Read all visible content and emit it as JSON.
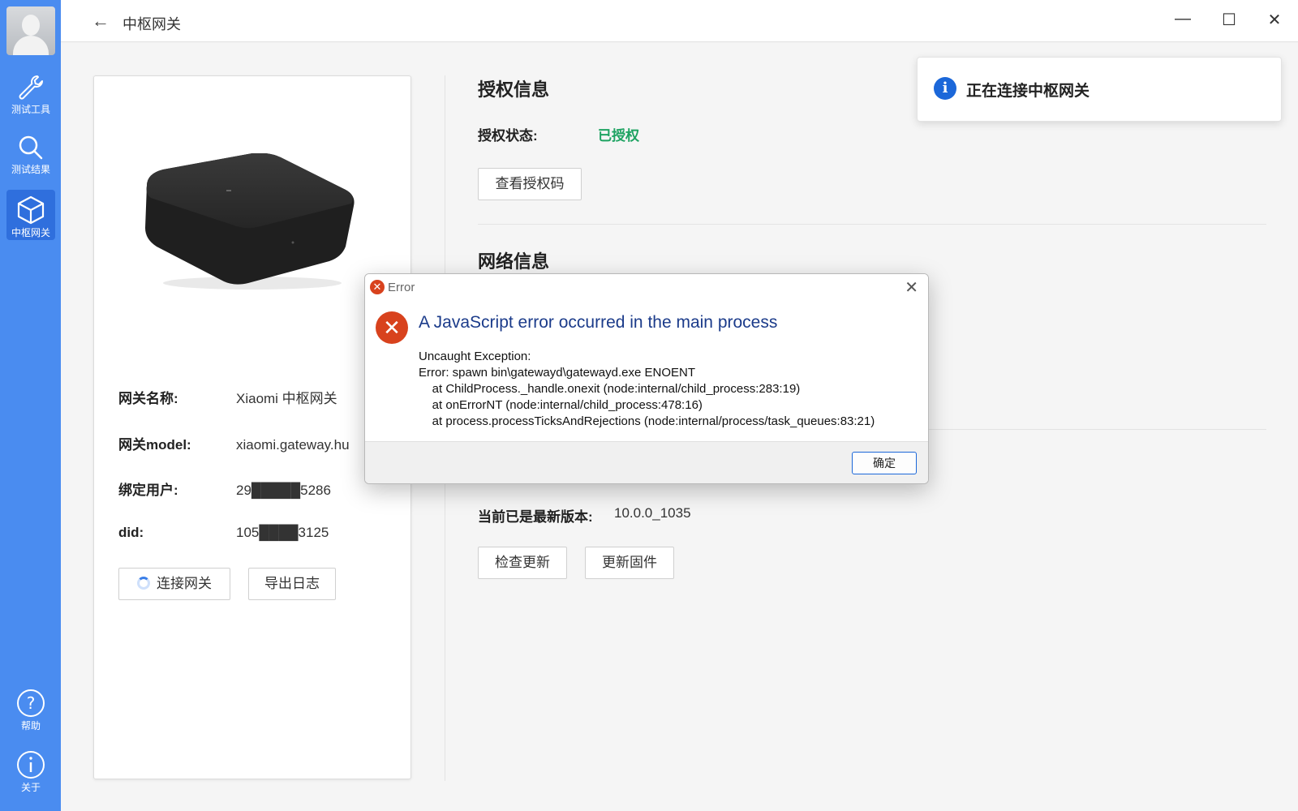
{
  "window": {
    "title": "中枢网关",
    "back_icon": "←",
    "minimize": "—",
    "maximize": "☐",
    "close": "✕"
  },
  "sidebar": {
    "items": [
      {
        "label": "测试工具",
        "icon": "wrench-icon"
      },
      {
        "label": "测试结果",
        "icon": "search-icon"
      },
      {
        "label": "中枢网关",
        "icon": "cube-icon",
        "active": true
      }
    ],
    "bottom_items": [
      {
        "label": "帮助",
        "icon": "help-icon"
      },
      {
        "label": "关于",
        "icon": "info-icon"
      }
    ]
  },
  "gateway": {
    "name_label": "网关名称:",
    "name_value": "Xiaomi 中枢网关",
    "model_label": "网关model:",
    "model_value": "xiaomi.gateway.hu",
    "user_label": "绑定用户:",
    "user_value": "29█████5286",
    "did_label": "did:",
    "did_value": "105████3125",
    "connect_button": "连接网关",
    "export_button": "导出日志"
  },
  "auth": {
    "section_title": "授权信息",
    "status_label": "授权状态:",
    "status_value": "已授权",
    "view_button": "查看授权码"
  },
  "network": {
    "section_title": "网络信息"
  },
  "firmware": {
    "version_label": "当前已是最新版本:",
    "version_value": "10.0.0_1035",
    "check_button": "检查更新",
    "update_button": "更新固件"
  },
  "toast": {
    "text": "正在连接中枢网关",
    "icon": "i"
  },
  "dialog": {
    "title": "Error",
    "heading": "A JavaScript error occurred in the main process",
    "body": "Uncaught Exception:\nError: spawn bin\\gatewayd\\gatewayd.exe ENOENT\n    at ChildProcess._handle.onexit (node:internal/child_process:283:19)\n    at onErrorNT (node:internal/child_process:478:16)\n    at process.processTicksAndRejections (node:internal/process/task_queues:83:21)",
    "ok_button": "确定",
    "close_icon": "✕",
    "error_icon": "✕"
  },
  "colors": {
    "sidebar": "#4a8cf0",
    "sidebar_active": "#2f6fdd",
    "ok_green": "#1ea362",
    "error_red": "#d8421d",
    "info_blue": "#1b67d9"
  }
}
